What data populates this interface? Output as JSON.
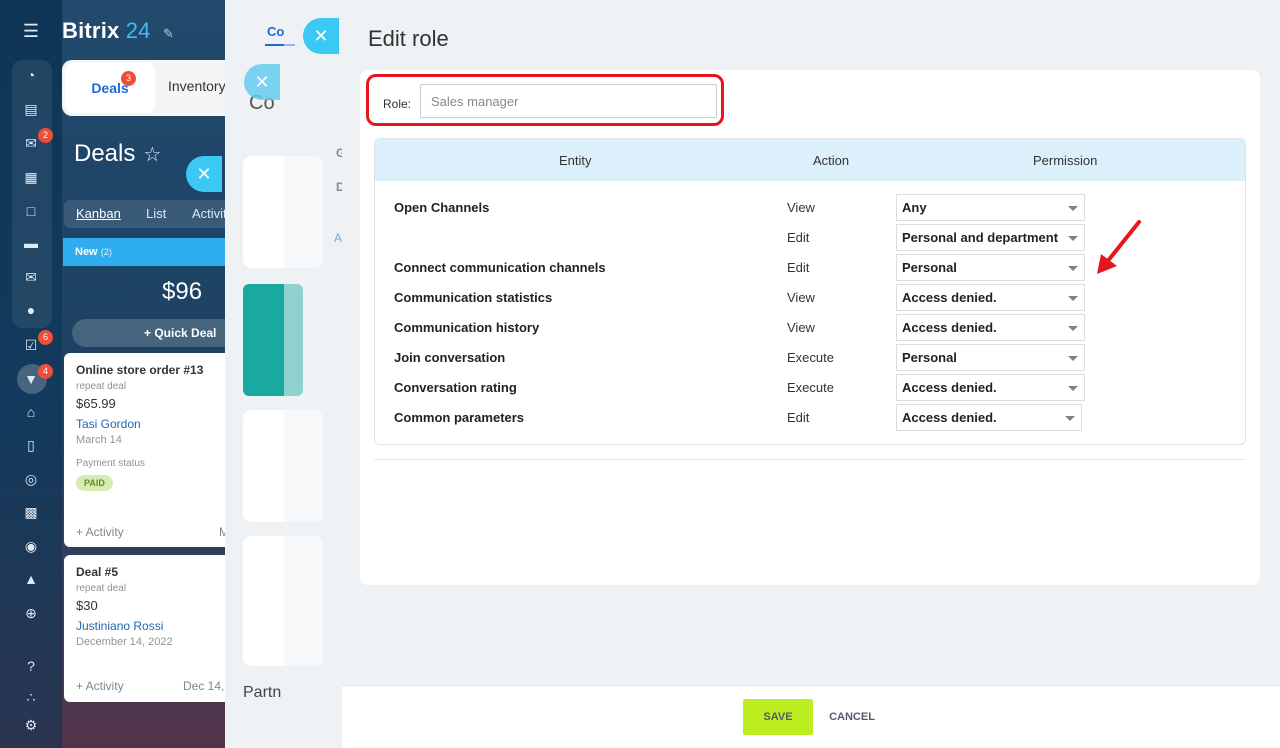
{
  "brand": {
    "name": "Bitrix",
    "num": "24"
  },
  "crm": {
    "tabs": {
      "deals": "Deals",
      "deals_badge": "3",
      "inventory": "Inventory"
    },
    "page_title": "Deals",
    "views": [
      "Kanban",
      "List",
      "Activities"
    ],
    "column": {
      "name": "New",
      "count": "(2)",
      "sum": "$96",
      "quick_deal": "Quick Deal"
    },
    "deals": [
      {
        "title": "Online store order #13",
        "sub": "repeat deal",
        "price": "$65.99",
        "contact": "Tasi Gordon",
        "date": "March 14",
        "payment_label": "Payment status",
        "payment_status": "PAID",
        "activity": "+ Activity",
        "activity_date": "M"
      },
      {
        "title": "Deal #5",
        "sub": "repeat deal",
        "price": "$30",
        "contact": "Justiniano Rossi",
        "date": "December 14, 2022",
        "activity": "+ Activity",
        "activity_date": "Dec 14,"
      }
    ]
  },
  "rail": {
    "badges": [
      "2",
      "6",
      "4"
    ]
  },
  "slider2": {
    "tab": "Co",
    "heading": "Co",
    "partners": "Partn"
  },
  "slider3": {
    "label_g": "G",
    "label_d": "D",
    "label_a": "A"
  },
  "editor": {
    "title": "Edit role",
    "role_label": "Role:",
    "role_placeholder": "Sales manager",
    "headers": {
      "entity": "Entity",
      "action": "Action",
      "permission": "Permission"
    },
    "rows": [
      {
        "entity": "Open Channels",
        "action": "View",
        "permission": "Any"
      },
      {
        "entity": "",
        "action": "Edit",
        "permission": "Personal and department"
      },
      {
        "entity": "Connect communication channels",
        "action": "Edit",
        "permission": "Personal"
      },
      {
        "entity": "Communication statistics",
        "action": "View",
        "permission": "Access denied."
      },
      {
        "entity": "Communication history",
        "action": "View",
        "permission": "Access denied."
      },
      {
        "entity": "Join conversation",
        "action": "Execute",
        "permission": "Personal"
      },
      {
        "entity": "Conversation rating",
        "action": "Execute",
        "permission": "Access denied."
      },
      {
        "entity": "Common parameters",
        "action": "Edit",
        "permission": "Access denied."
      }
    ],
    "save_label": "SAVE",
    "cancel_label": "CANCEL"
  },
  "colors": {
    "accent_save": "#bbed21",
    "highlight": "#e5161d",
    "header_bg": "#dcf0fb"
  },
  "icons": [
    "menu-icon",
    "chart-icon",
    "feed-icon",
    "chat-icon",
    "calendar-icon",
    "document-icon",
    "drive-icon",
    "mail-icon",
    "groups-icon",
    "tasks-icon",
    "crm-icon",
    "bank-icon",
    "cart-icon",
    "target-icon",
    "contact-card-icon",
    "robot-icon",
    "box-icon",
    "more-icon",
    "help-icon",
    "structure-icon",
    "settings-icon",
    "pencil-icon",
    "star-icon",
    "plus-icon",
    "close-icon",
    "arrow-icon"
  ]
}
